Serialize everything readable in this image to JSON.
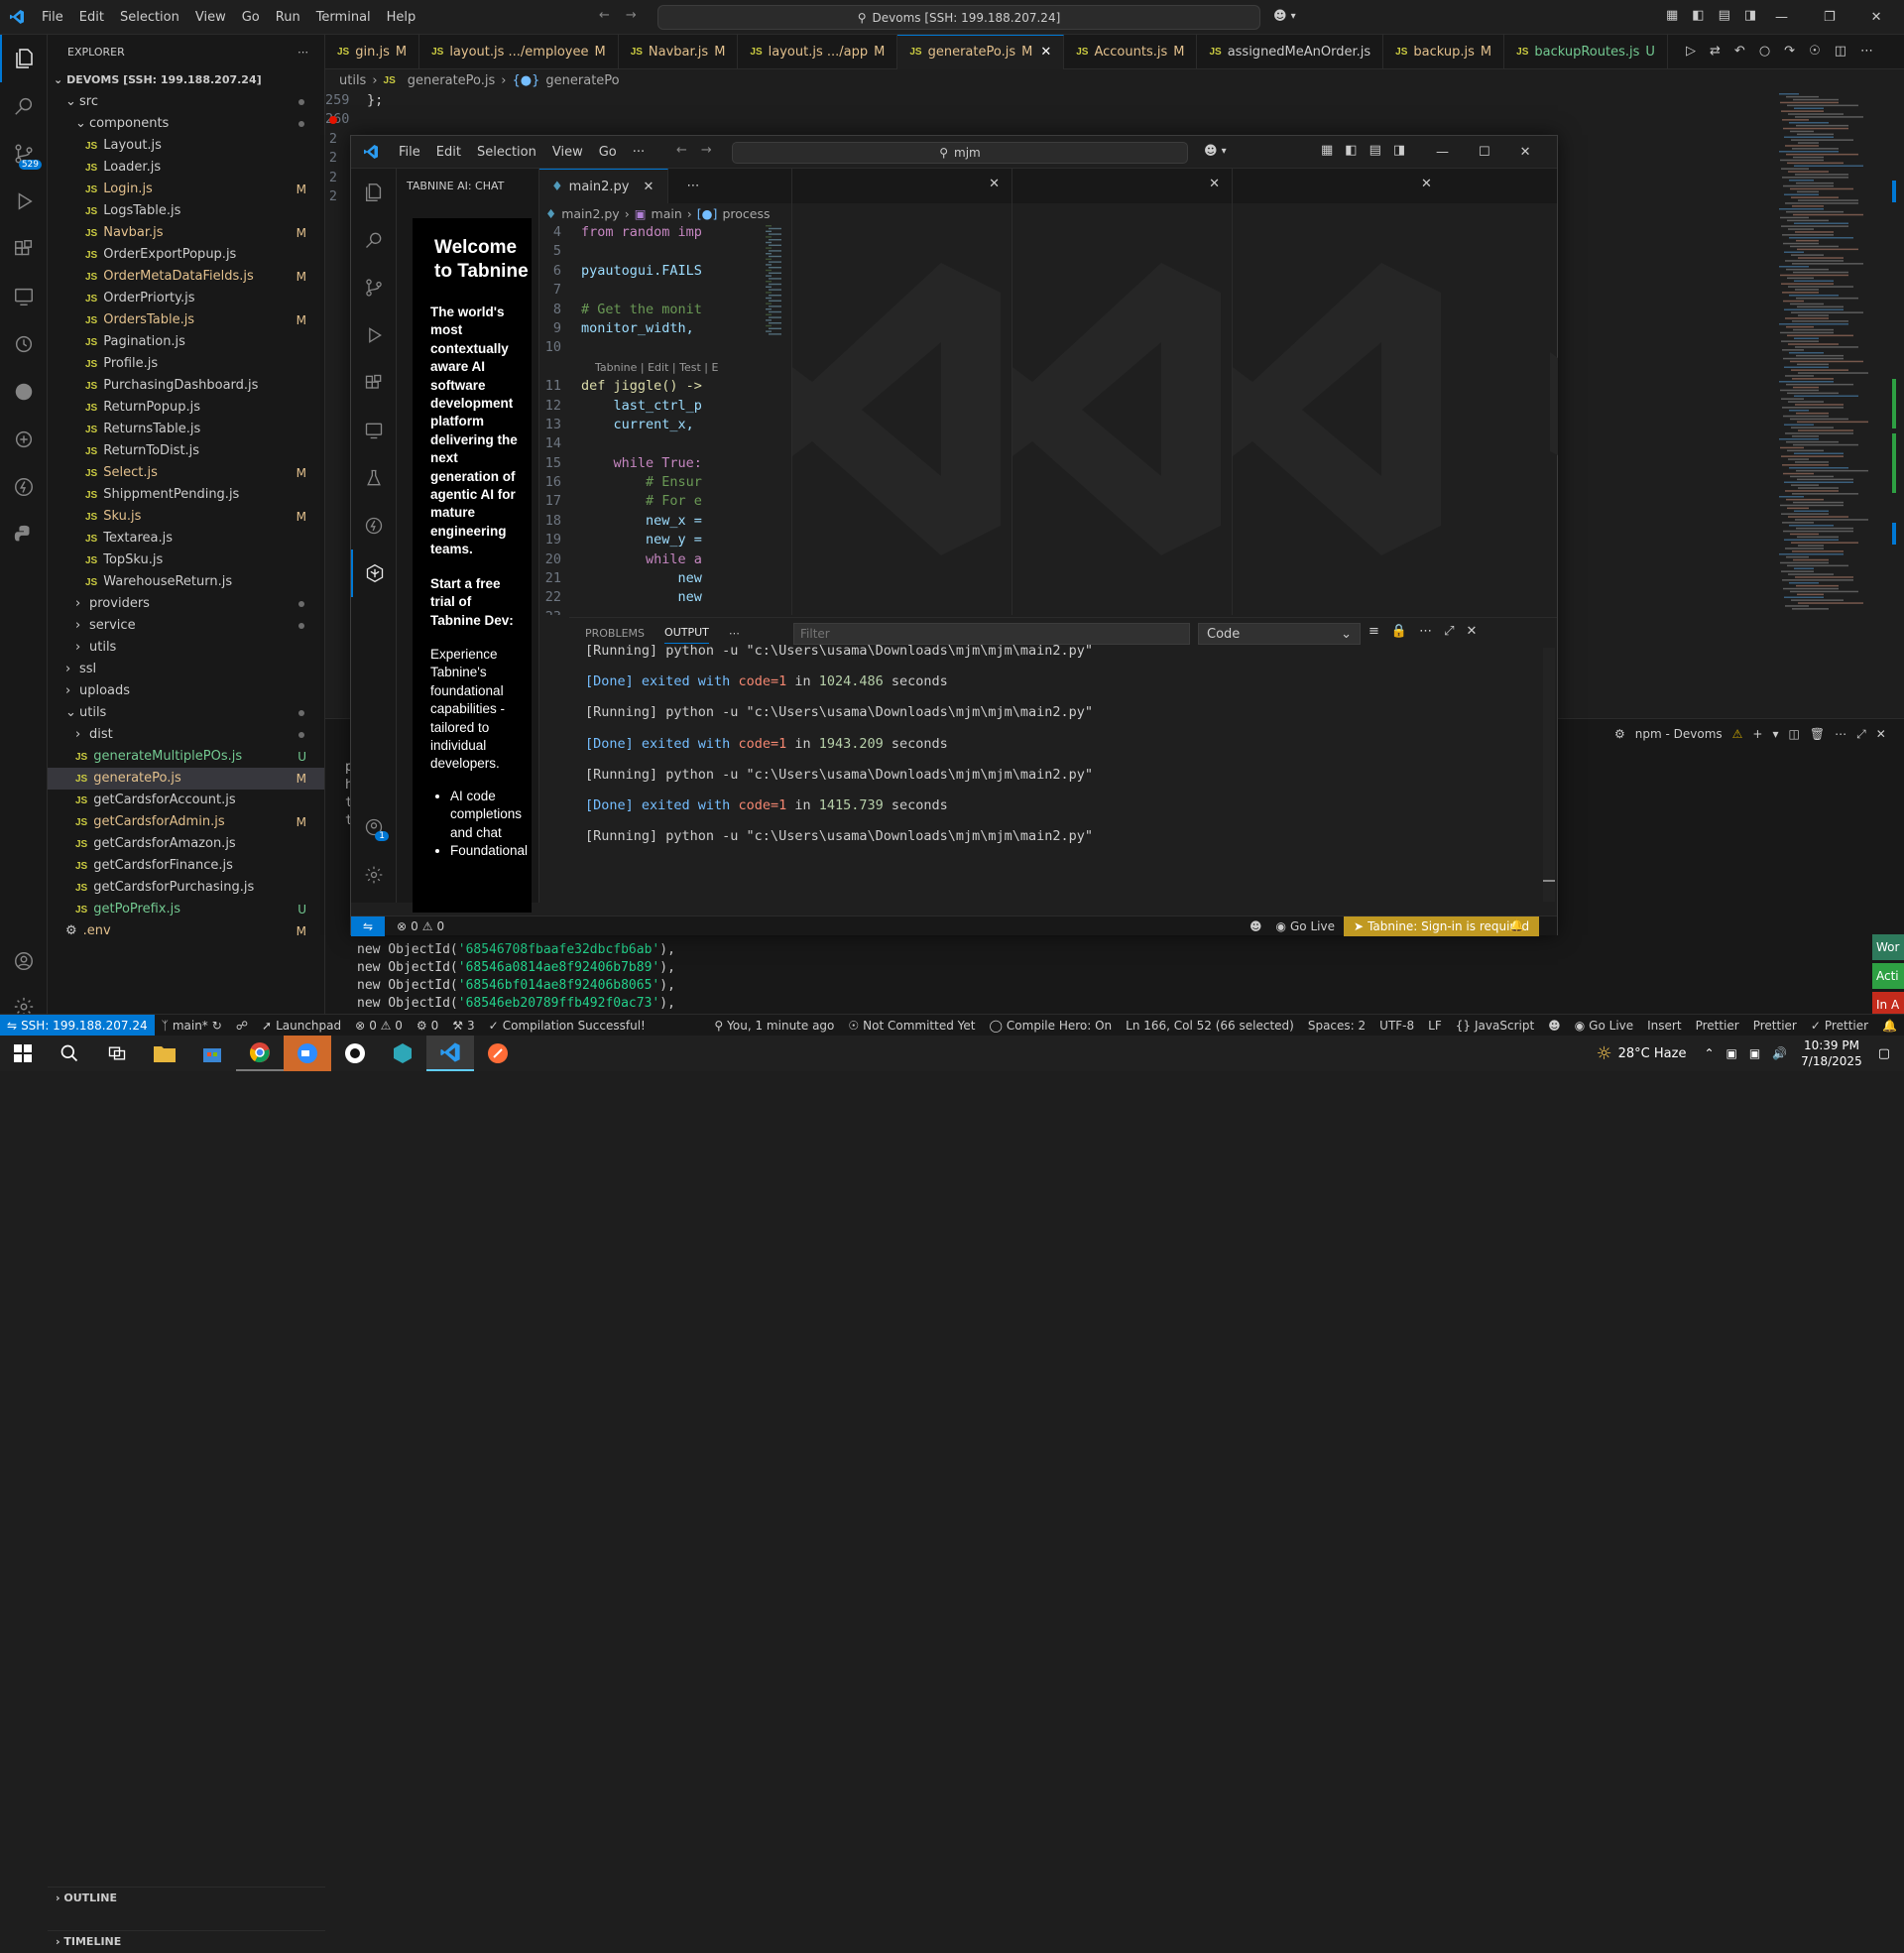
{
  "titlebar": {
    "menu": [
      "File",
      "Edit",
      "Selection",
      "View",
      "Go",
      "Run",
      "Terminal",
      "Help"
    ],
    "command_center": "Devoms [SSH: 199.188.207.24]"
  },
  "sidebar": {
    "title": "EXPLORER",
    "root": "DEVOMS [SSH: 199.188.207.24]",
    "rows": [
      {
        "type": "folder",
        "name": "src",
        "indent": 1,
        "open": true,
        "dot": true
      },
      {
        "type": "folder",
        "name": "components",
        "indent": 2,
        "open": true,
        "dot": true
      },
      {
        "type": "file",
        "name": "Layout.js",
        "indent": 3
      },
      {
        "type": "file",
        "name": "Loader.js",
        "indent": 3
      },
      {
        "type": "file",
        "name": "Login.js",
        "indent": 3,
        "badge": "M"
      },
      {
        "type": "file",
        "name": "LogsTable.js",
        "indent": 3
      },
      {
        "type": "file",
        "name": "Navbar.js",
        "indent": 3,
        "badge": "M"
      },
      {
        "type": "file",
        "name": "OrderExportPopup.js",
        "indent": 3
      },
      {
        "type": "file",
        "name": "OrderMetaDataFields.js",
        "indent": 3,
        "badge": "M"
      },
      {
        "type": "file",
        "name": "OrderPriorty.js",
        "indent": 3
      },
      {
        "type": "file",
        "name": "OrdersTable.js",
        "indent": 3,
        "badge": "M"
      },
      {
        "type": "file",
        "name": "Pagination.js",
        "indent": 3
      },
      {
        "type": "file",
        "name": "Profile.js",
        "indent": 3
      },
      {
        "type": "file",
        "name": "PurchasingDashboard.js",
        "indent": 3
      },
      {
        "type": "file",
        "name": "ReturnPopup.js",
        "indent": 3
      },
      {
        "type": "file",
        "name": "ReturnsTable.js",
        "indent": 3
      },
      {
        "type": "file",
        "name": "ReturnToDist.js",
        "indent": 3
      },
      {
        "type": "file",
        "name": "Select.js",
        "indent": 3,
        "badge": "M"
      },
      {
        "type": "file",
        "name": "ShippmentPending.js",
        "indent": 3
      },
      {
        "type": "file",
        "name": "Sku.js",
        "indent": 3,
        "badge": "M"
      },
      {
        "type": "file",
        "name": "Textarea.js",
        "indent": 3
      },
      {
        "type": "file",
        "name": "TopSku.js",
        "indent": 3
      },
      {
        "type": "file",
        "name": "WarehouseReturn.js",
        "indent": 3
      },
      {
        "type": "folder",
        "name": "providers",
        "indent": 2,
        "dot": true
      },
      {
        "type": "folder",
        "name": "service",
        "indent": 2,
        "dot": true
      },
      {
        "type": "folder",
        "name": "utils",
        "indent": 2
      },
      {
        "type": "folder",
        "name": "ssl",
        "indent": 1
      },
      {
        "type": "folder",
        "name": "uploads",
        "indent": 1
      },
      {
        "type": "folder",
        "name": "utils",
        "indent": 1,
        "open": true,
        "dot": true
      },
      {
        "type": "folder",
        "name": "dist",
        "indent": 2,
        "dot": true
      },
      {
        "type": "file",
        "name": "generateMultiplePOs.js",
        "indent": 2,
        "badge": "U"
      },
      {
        "type": "file",
        "name": "generatePo.js",
        "indent": 2,
        "badge": "M",
        "selected": true
      },
      {
        "type": "file",
        "name": "getCardsforAccount.js",
        "indent": 2
      },
      {
        "type": "file",
        "name": "getCardsforAdmin.js",
        "indent": 2,
        "badge": "M"
      },
      {
        "type": "file",
        "name": "getCardsforAmazon.js",
        "indent": 2
      },
      {
        "type": "file",
        "name": "getCardsforFinance.js",
        "indent": 2
      },
      {
        "type": "file",
        "name": "getCardsforPurchasing.js",
        "indent": 2
      },
      {
        "type": "file",
        "name": "getPoPrefix.js",
        "indent": 2,
        "badge": "U"
      },
      {
        "type": "env",
        "name": ".env",
        "indent": 1,
        "badge": "M"
      }
    ],
    "outline": "OUTLINE",
    "timeline": "TIMELINE"
  },
  "tabs": [
    {
      "label": "gin.js",
      "badge": "M"
    },
    {
      "label": "layout.js .../employee",
      "badge": "M"
    },
    {
      "label": "Navbar.js",
      "badge": "M"
    },
    {
      "label": "layout.js .../app",
      "badge": "M"
    },
    {
      "label": "generatePo.js",
      "badge": "M",
      "active": true
    },
    {
      "label": "Accounts.js",
      "badge": "M"
    },
    {
      "label": "assignedMeAnOrder.js",
      "badge": ""
    },
    {
      "label": "backup.js",
      "badge": "M"
    },
    {
      "label": "backupRoutes.js",
      "badge": "U"
    }
  ],
  "breadcrumb": {
    "a": "utils",
    "b": "generatePo.js",
    "c": "generatePo"
  },
  "outer_code": [
    {
      "ln": "259",
      "text": "};"
    },
    {
      "ln": "260",
      "text": ""
    }
  ],
  "inner": {
    "menu": [
      "File",
      "Edit",
      "Selection",
      "View",
      "Go",
      "···"
    ],
    "search": "mjm",
    "tabnine_title": "TABNINE AI: CHAT",
    "welcome": "Welcome to Tabnine",
    "tagline": "The world's most contextually aware AI software development platform delivering the next generation of agentic AI for mature engineering teams.",
    "trial": "Start a free trial of Tabnine Dev:",
    "trial_desc": "Experience Tabnine's foundational capabilities - tailored to individual developers.",
    "bullets": [
      "AI code completions and chat",
      "Foundational"
    ],
    "editor_tab": "main2.py",
    "breadcrumb": {
      "a": "main2.py",
      "b": "main",
      "c": "process"
    },
    "codelens": "Tabnine | Edit | Test | E",
    "code": [
      {
        "ln": "4",
        "text": "from random imp"
      },
      {
        "ln": "5",
        "text": ""
      },
      {
        "ln": "6",
        "text": "pyautogui.FAILS"
      },
      {
        "ln": "7",
        "text": ""
      },
      {
        "ln": "8",
        "text": "# Get the monit"
      },
      {
        "ln": "9",
        "text": "monitor_width,"
      },
      {
        "ln": "10",
        "text": ""
      },
      {
        "ln": "11",
        "text": "def jiggle() ->"
      },
      {
        "ln": "12",
        "text": "    last_ctrl_p"
      },
      {
        "ln": "13",
        "text": "    current_x,"
      },
      {
        "ln": "14",
        "text": ""
      },
      {
        "ln": "15",
        "text": "    while True:"
      },
      {
        "ln": "16",
        "text": "        # Ensur"
      },
      {
        "ln": "17",
        "text": "        # For e"
      },
      {
        "ln": "18",
        "text": "        new_x ="
      },
      {
        "ln": "19",
        "text": "        new_y ="
      },
      {
        "ln": "20",
        "text": "        while a"
      },
      {
        "ln": "21",
        "text": "            new"
      },
      {
        "ln": "22",
        "text": "            new"
      },
      {
        "ln": "23",
        "text": ""
      }
    ],
    "panel_tabs": [
      "PROBLEMS",
      "OUTPUT"
    ],
    "filter_placeholder": "Filter",
    "output_channel": "Code",
    "output": [
      {
        "kind": "running",
        "text": "[Running] python -u \"c:\\Users\\usama\\Downloads\\mjm\\mjm\\main2.py\""
      },
      {
        "kind": "done",
        "pre": "[Done] exited with ",
        "code": "code=1",
        "mid": " in ",
        "secs": "1024.486",
        "post": " seconds"
      },
      {
        "kind": "running",
        "text": "[Running] python -u \"c:\\Users\\usama\\Downloads\\mjm\\mjm\\main2.py\""
      },
      {
        "kind": "done",
        "pre": "[Done] exited with ",
        "code": "code=1",
        "mid": " in ",
        "secs": "1943.209",
        "post": " seconds"
      },
      {
        "kind": "running",
        "text": "[Running] python -u \"c:\\Users\\usama\\Downloads\\mjm\\mjm\\main2.py\""
      },
      {
        "kind": "done",
        "pre": "[Done] exited with ",
        "code": "code=1",
        "mid": " in ",
        "secs": "1415.739",
        "post": " seconds"
      },
      {
        "kind": "running",
        "text": "[Running] python -u \"c:\\Users\\usama\\Downloads\\mjm\\mjm\\main2.py\""
      }
    ],
    "status": {
      "errors": "0",
      "warnings": "0",
      "golive": "Go Live",
      "tabnine": "Tabnine: Sign-in is required"
    },
    "badge_count": "1"
  },
  "terminal": {
    "label": "npm - Devoms",
    "lines": [
      {
        "a": "new ObjectId(",
        "id": "'68546708fbaafe32dbcfb6ab'",
        "b": "),"
      },
      {
        "a": "new ObjectId(",
        "id": "'68546a0814ae8f92406b7b89'",
        "b": "),"
      },
      {
        "a": "new ObjectId(",
        "id": "'68546bf014ae8f92406b8065'",
        "b": "),"
      },
      {
        "a": "new ObjectId(",
        "id": "'68546eb20789ffb492f0ac73'",
        "b": "),"
      }
    ],
    "peek": [
      "p",
      "h",
      "t",
      "t"
    ]
  },
  "right_edge": [
    "Wor",
    "Acti",
    "In A"
  ],
  "statusbar": {
    "remote": "SSH: 199.188.207.24",
    "branch": "main*",
    "launchpad": "Launchpad",
    "problems": "0 ⚠ 0",
    "ports": "0",
    "tasks": "3",
    "compilation": "Compilation Successful!",
    "blame": "You, 1 minute ago",
    "commit": "Not Committed Yet",
    "compilehero": "Compile Hero: On",
    "position": "Ln 166, Col 52 (66 selected)",
    "spaces": "Spaces: 2",
    "encoding": "UTF-8",
    "eol": "LF",
    "language": "JavaScript",
    "golive": "Go Live",
    "insert": "Insert",
    "prettier1": "Prettier",
    "prettier2": "Prettier",
    "prettier3": "Prettier"
  },
  "taskbar": {
    "weather": "28°C  Haze",
    "time": "10:39 PM",
    "date": "7/18/2025"
  },
  "colors": {
    "accent": "#0078d4",
    "modified": "#e2c08d",
    "untracked": "#73c991",
    "remote": "#16825d",
    "tabnine_warn": "#c09922"
  }
}
